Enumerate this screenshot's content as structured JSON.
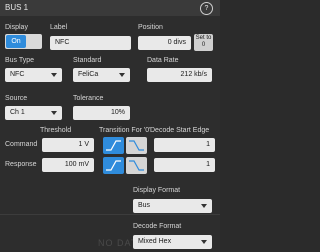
{
  "window": {
    "title": "BUS 1"
  },
  "display": {
    "label": "Display",
    "value": "On"
  },
  "label_field": {
    "label": "Label",
    "value": "NFC"
  },
  "position": {
    "label": "Position",
    "value": "0 divs",
    "set_btn": "Set to 0"
  },
  "bus_type": {
    "label": "Bus Type",
    "value": "NFC"
  },
  "standard": {
    "label": "Standard",
    "value": "FeliCa"
  },
  "data_rate": {
    "label": "Data Rate",
    "value": "212 kb/s"
  },
  "source": {
    "label": "Source",
    "value": "Ch 1"
  },
  "tolerance": {
    "label": "Tolerance",
    "value": "10%"
  },
  "headers": {
    "threshold": "Threshold",
    "transition": "Transition For '0'",
    "decode_start": "Decode Start Edge"
  },
  "command": {
    "label": "Command",
    "threshold": "1 V",
    "decode_start": "1"
  },
  "response": {
    "label": "Response",
    "threshold": "100 mV",
    "decode_start": "1"
  },
  "display_format": {
    "label": "Display Format",
    "value": "Bus"
  },
  "decode_format": {
    "label": "Decode Format",
    "value": "Mixed Hex"
  },
  "background_text": "NO DATA",
  "colors": {
    "accent": "#2f8cdc",
    "panel": "#2d2d2d",
    "field": "#e9e9e9"
  },
  "icons": {
    "help": "help-icon",
    "rising": "rising-edge-icon",
    "falling": "falling-edge-icon"
  }
}
